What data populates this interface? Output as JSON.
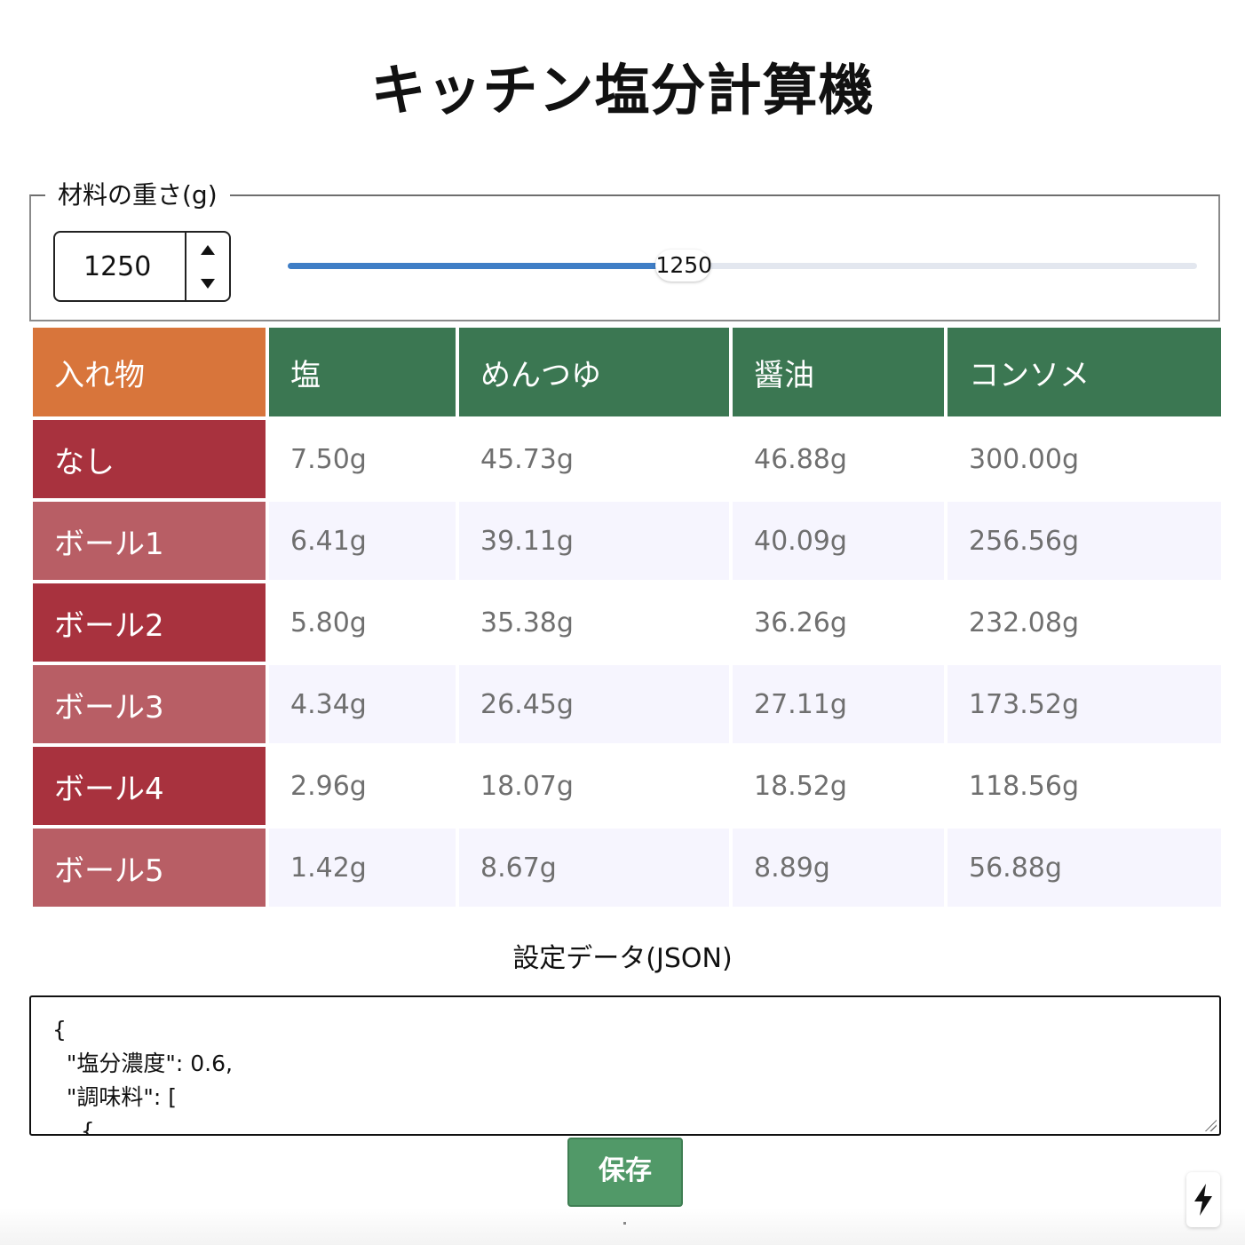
{
  "page": {
    "title": "キッチン塩分計算機"
  },
  "weight": {
    "legend": "材料の重さ(g)",
    "value": "1250",
    "slider_fraction": 0.435
  },
  "table": {
    "corner": "入れ物",
    "columns": [
      "塩",
      "めんつゆ",
      "醤油",
      "コンソメ"
    ],
    "rows": [
      {
        "label": "なし",
        "cells": [
          "7.50g",
          "45.73g",
          "46.88g",
          "300.00g"
        ]
      },
      {
        "label": "ボール1",
        "cells": [
          "6.41g",
          "39.11g",
          "40.09g",
          "256.56g"
        ]
      },
      {
        "label": "ボール2",
        "cells": [
          "5.80g",
          "35.38g",
          "36.26g",
          "232.08g"
        ]
      },
      {
        "label": "ボール3",
        "cells": [
          "4.34g",
          "26.45g",
          "27.11g",
          "173.52g"
        ]
      },
      {
        "label": "ボール4",
        "cells": [
          "2.96g",
          "18.07g",
          "18.52g",
          "118.56g"
        ]
      },
      {
        "label": "ボール5",
        "cells": [
          "1.42g",
          "8.67g",
          "8.89g",
          "56.88g"
        ]
      }
    ]
  },
  "json_section": {
    "title": "設定データ(JSON)",
    "lines": [
      "{",
      "  \"塩分濃度\": 0.6,",
      "  \"調味料\": [",
      "    {"
    ]
  },
  "save_button": {
    "label": "保存"
  },
  "colors": {
    "header_green": "#3b7752",
    "corner_orange": "#d8753b",
    "row_dark_red": "#a8323e",
    "row_light_red": "#b85e65",
    "slider_blue": "#3f7ec6",
    "save_green": "#519968"
  },
  "icons": {
    "corner_button": "lightning-bolt-icon"
  }
}
